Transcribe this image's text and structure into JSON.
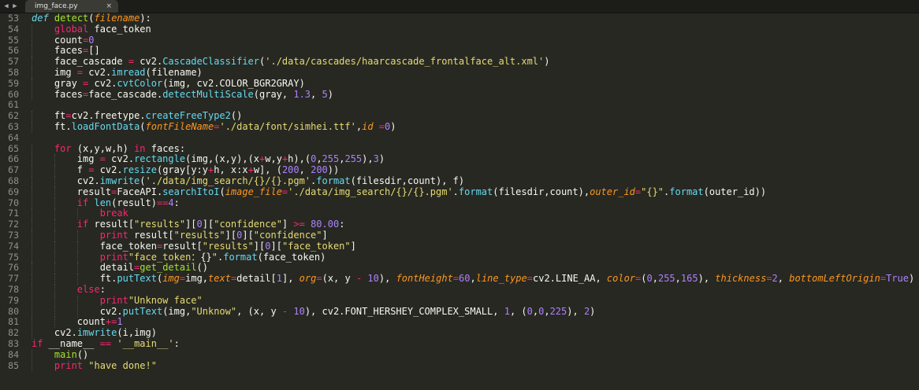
{
  "tabs": [
    {
      "title": "img_face.py",
      "close_glyph": "×"
    }
  ],
  "nav": {
    "left": "◀",
    "right": "▶"
  },
  "theme": {
    "background": "#272822",
    "keyword": "#f92672",
    "function": "#a6e22e",
    "builtin": "#66d9ef",
    "string": "#e6db74",
    "number": "#ae81ff",
    "argument": "#fd971f",
    "text": "#f8f8f2",
    "gutter": "#8f908a"
  },
  "lines": [
    {
      "n": "53",
      "indent": 0,
      "tokens": [
        [
          "st",
          "def"
        ],
        [
          "pl",
          " "
        ],
        [
          "fn",
          "detect"
        ],
        [
          "pl",
          "("
        ],
        [
          "arg",
          "filename"
        ],
        [
          "pl",
          "):"
        ]
      ]
    },
    {
      "n": "54",
      "indent": 1,
      "tokens": [
        [
          "kw",
          "global"
        ],
        [
          "pl",
          " face_token"
        ]
      ]
    },
    {
      "n": "55",
      "indent": 1,
      "tokens": [
        [
          "pl",
          "count"
        ],
        [
          "op",
          "="
        ],
        [
          "num",
          "0"
        ]
      ]
    },
    {
      "n": "56",
      "indent": 1,
      "tokens": [
        [
          "pl",
          "faces"
        ],
        [
          "op",
          "="
        ],
        [
          "pl",
          "[]"
        ]
      ]
    },
    {
      "n": "57",
      "indent": 1,
      "tokens": [
        [
          "pl",
          "face_cascade "
        ],
        [
          "op",
          "="
        ],
        [
          "pl",
          " cv2."
        ],
        [
          "fc",
          "CascadeClassifier"
        ],
        [
          "pl",
          "("
        ],
        [
          "str",
          "'./data/cascades/haarcascade_frontalface_alt.xml'"
        ],
        [
          "pl",
          ")"
        ]
      ]
    },
    {
      "n": "58",
      "indent": 1,
      "tokens": [
        [
          "pl",
          "img "
        ],
        [
          "op",
          "="
        ],
        [
          "pl",
          " cv2."
        ],
        [
          "fc",
          "imread"
        ],
        [
          "pl",
          "(filename)"
        ]
      ]
    },
    {
      "n": "59",
      "indent": 1,
      "tokens": [
        [
          "pl",
          "gray "
        ],
        [
          "op",
          "="
        ],
        [
          "pl",
          " cv2."
        ],
        [
          "fc",
          "cvtColor"
        ],
        [
          "pl",
          "(img, cv2.COLOR_BGR2GRAY)"
        ]
      ]
    },
    {
      "n": "60",
      "indent": 1,
      "tokens": [
        [
          "pl",
          "faces"
        ],
        [
          "op",
          "="
        ],
        [
          "pl",
          "face_cascade."
        ],
        [
          "fc",
          "detectMultiScale"
        ],
        [
          "pl",
          "(gray, "
        ],
        [
          "num",
          "1.3"
        ],
        [
          "pl",
          ", "
        ],
        [
          "num",
          "5"
        ],
        [
          "pl",
          ")"
        ]
      ]
    },
    {
      "n": "61",
      "indent": 0,
      "tokens": []
    },
    {
      "n": "62",
      "indent": 1,
      "tokens": [
        [
          "pl",
          "ft"
        ],
        [
          "op",
          "="
        ],
        [
          "pl",
          "cv2.freetype."
        ],
        [
          "fc",
          "createFreeType2"
        ],
        [
          "pl",
          "()"
        ]
      ]
    },
    {
      "n": "63",
      "indent": 1,
      "tokens": [
        [
          "pl",
          "ft."
        ],
        [
          "fc",
          "loadFontData"
        ],
        [
          "pl",
          "("
        ],
        [
          "arg",
          "fontFileName"
        ],
        [
          "op",
          "="
        ],
        [
          "str",
          "'./data/font/simhei.ttf'"
        ],
        [
          "pl",
          ","
        ],
        [
          "arg",
          "id"
        ],
        [
          "pl",
          " "
        ],
        [
          "op",
          "="
        ],
        [
          "num",
          "0"
        ],
        [
          "pl",
          ")"
        ]
      ]
    },
    {
      "n": "64",
      "indent": 0,
      "tokens": []
    },
    {
      "n": "65",
      "indent": 1,
      "tokens": [
        [
          "kw",
          "for"
        ],
        [
          "pl",
          " (x,y,w,h) "
        ],
        [
          "kw",
          "in"
        ],
        [
          "pl",
          " faces:"
        ]
      ]
    },
    {
      "n": "66",
      "indent": 2,
      "tokens": [
        [
          "pl",
          "img "
        ],
        [
          "op",
          "="
        ],
        [
          "pl",
          " cv2."
        ],
        [
          "fc",
          "rectangle"
        ],
        [
          "pl",
          "(img,(x,y),(x"
        ],
        [
          "op",
          "+"
        ],
        [
          "pl",
          "w,y"
        ],
        [
          "op",
          "+"
        ],
        [
          "pl",
          "h),("
        ],
        [
          "num",
          "0"
        ],
        [
          "pl",
          ","
        ],
        [
          "num",
          "255"
        ],
        [
          "pl",
          ","
        ],
        [
          "num",
          "255"
        ],
        [
          "pl",
          "),"
        ],
        [
          "num",
          "3"
        ],
        [
          "pl",
          ")"
        ]
      ]
    },
    {
      "n": "67",
      "indent": 2,
      "tokens": [
        [
          "pl",
          "f "
        ],
        [
          "op",
          "="
        ],
        [
          "pl",
          " cv2."
        ],
        [
          "fc",
          "resize"
        ],
        [
          "pl",
          "(gray[y:y"
        ],
        [
          "op",
          "+"
        ],
        [
          "pl",
          "h, x:x"
        ],
        [
          "op",
          "+"
        ],
        [
          "pl",
          "w], ("
        ],
        [
          "num",
          "200"
        ],
        [
          "pl",
          ", "
        ],
        [
          "num",
          "200"
        ],
        [
          "pl",
          "))"
        ]
      ]
    },
    {
      "n": "68",
      "indent": 2,
      "tokens": [
        [
          "pl",
          "cv2."
        ],
        [
          "fc",
          "imwrite"
        ],
        [
          "pl",
          "("
        ],
        [
          "str",
          "'./data/img_search/{}/{}.pgm'"
        ],
        [
          "pl",
          "."
        ],
        [
          "fc",
          "format"
        ],
        [
          "pl",
          "(filesdir,count), f)"
        ]
      ]
    },
    {
      "n": "69",
      "indent": 2,
      "tokens": [
        [
          "pl",
          "result"
        ],
        [
          "op",
          "="
        ],
        [
          "pl",
          "FaceAPI."
        ],
        [
          "fc",
          "searchItoI"
        ],
        [
          "pl",
          "("
        ],
        [
          "arg",
          "image_file"
        ],
        [
          "op",
          "="
        ],
        [
          "str",
          "'./data/img_search/{}/{}.pgm'"
        ],
        [
          "pl",
          "."
        ],
        [
          "fc",
          "format"
        ],
        [
          "pl",
          "(filesdir,count),"
        ],
        [
          "arg",
          "outer_id"
        ],
        [
          "op",
          "="
        ],
        [
          "str",
          "\"{}\""
        ],
        [
          "pl",
          "."
        ],
        [
          "fc",
          "format"
        ],
        [
          "pl",
          "(outer_id))"
        ]
      ]
    },
    {
      "n": "70",
      "indent": 2,
      "tokens": [
        [
          "kw",
          "if"
        ],
        [
          "pl",
          " "
        ],
        [
          "fc",
          "len"
        ],
        [
          "pl",
          "(result)"
        ],
        [
          "op",
          "=="
        ],
        [
          "num",
          "4"
        ],
        [
          "pl",
          ":"
        ]
      ]
    },
    {
      "n": "71",
      "indent": 3,
      "tokens": [
        [
          "kw",
          "break"
        ]
      ]
    },
    {
      "n": "72",
      "indent": 2,
      "tokens": [
        [
          "kw",
          "if"
        ],
        [
          "pl",
          " result["
        ],
        [
          "str",
          "\"results\""
        ],
        [
          "pl",
          "]["
        ],
        [
          "num",
          "0"
        ],
        [
          "pl",
          "]["
        ],
        [
          "str",
          "\"confidence\""
        ],
        [
          "pl",
          "] "
        ],
        [
          "op",
          ">="
        ],
        [
          "pl",
          " "
        ],
        [
          "num",
          "80.00"
        ],
        [
          "pl",
          ":"
        ]
      ]
    },
    {
      "n": "73",
      "indent": 3,
      "tokens": [
        [
          "kw",
          "print"
        ],
        [
          "pl",
          " result["
        ],
        [
          "str",
          "\"results\""
        ],
        [
          "pl",
          "]["
        ],
        [
          "num",
          "0"
        ],
        [
          "pl",
          "]["
        ],
        [
          "str",
          "\"confidence\""
        ],
        [
          "pl",
          "]"
        ]
      ]
    },
    {
      "n": "74",
      "indent": 3,
      "tokens": [
        [
          "pl",
          "face_token"
        ],
        [
          "op",
          "="
        ],
        [
          "pl",
          "result["
        ],
        [
          "str",
          "\"results\""
        ],
        [
          "pl",
          "]["
        ],
        [
          "num",
          "0"
        ],
        [
          "pl",
          "]["
        ],
        [
          "str",
          "\"face_token\""
        ],
        [
          "pl",
          "]"
        ]
      ]
    },
    {
      "n": "75",
      "indent": 3,
      "tokens": [
        [
          "kw",
          "print"
        ],
        [
          "str",
          "\"face_token："
        ],
        [
          "pl",
          "{}"
        ],
        [
          "str",
          "\""
        ],
        [
          "pl",
          "."
        ],
        [
          "fc",
          "format"
        ],
        [
          "pl",
          "(face_token)"
        ]
      ]
    },
    {
      "n": "76",
      "indent": 3,
      "tokens": [
        [
          "pl",
          "detail"
        ],
        [
          "op",
          "="
        ],
        [
          "fn",
          "get_detail"
        ],
        [
          "pl",
          "()"
        ]
      ]
    },
    {
      "n": "77",
      "indent": 3,
      "tokens": [
        [
          "pl",
          "ft."
        ],
        [
          "fc",
          "putText"
        ],
        [
          "pl",
          "("
        ],
        [
          "arg",
          "img"
        ],
        [
          "op",
          "="
        ],
        [
          "pl",
          "img,"
        ],
        [
          "arg",
          "text"
        ],
        [
          "op",
          "="
        ],
        [
          "pl",
          "detail["
        ],
        [
          "num",
          "1"
        ],
        [
          "pl",
          "], "
        ],
        [
          "arg",
          "org"
        ],
        [
          "op",
          "="
        ],
        [
          "pl",
          "(x, y "
        ],
        [
          "op",
          "-"
        ],
        [
          "pl",
          " "
        ],
        [
          "num",
          "10"
        ],
        [
          "pl",
          "), "
        ],
        [
          "arg",
          "fontHeight"
        ],
        [
          "op",
          "="
        ],
        [
          "num",
          "60"
        ],
        [
          "pl",
          ","
        ],
        [
          "arg",
          "line_type"
        ],
        [
          "op",
          "="
        ],
        [
          "pl",
          "cv2.LINE_AA, "
        ],
        [
          "arg",
          "color"
        ],
        [
          "op",
          "="
        ],
        [
          "pl",
          "("
        ],
        [
          "num",
          "0"
        ],
        [
          "pl",
          ","
        ],
        [
          "num",
          "255"
        ],
        [
          "pl",
          ","
        ],
        [
          "num",
          "165"
        ],
        [
          "pl",
          "), "
        ],
        [
          "arg",
          "thickness"
        ],
        [
          "op",
          "="
        ],
        [
          "num",
          "2"
        ],
        [
          "pl",
          ", "
        ],
        [
          "arg",
          "bottomLeftOrigin"
        ],
        [
          "op",
          "="
        ],
        [
          "num",
          "True"
        ],
        [
          "pl",
          ")"
        ]
      ]
    },
    {
      "n": "78",
      "indent": 2,
      "tokens": [
        [
          "kw",
          "else"
        ],
        [
          "pl",
          ":"
        ]
      ]
    },
    {
      "n": "79",
      "indent": 3,
      "tokens": [
        [
          "kw",
          "print"
        ],
        [
          "str",
          "\"Unknow face\""
        ]
      ]
    },
    {
      "n": "80",
      "indent": 3,
      "tokens": [
        [
          "pl",
          "cv2."
        ],
        [
          "fc",
          "putText"
        ],
        [
          "pl",
          "(img,"
        ],
        [
          "str",
          "\"Unknow\""
        ],
        [
          "pl",
          ", (x, y "
        ],
        [
          "op",
          "-"
        ],
        [
          "pl",
          " "
        ],
        [
          "num",
          "10"
        ],
        [
          "pl",
          "), cv2.FONT_HERSHEY_COMPLEX_SMALL, "
        ],
        [
          "num",
          "1"
        ],
        [
          "pl",
          ", ("
        ],
        [
          "num",
          "0"
        ],
        [
          "pl",
          ","
        ],
        [
          "num",
          "0"
        ],
        [
          "pl",
          ","
        ],
        [
          "num",
          "225"
        ],
        [
          "pl",
          "), "
        ],
        [
          "num",
          "2"
        ],
        [
          "pl",
          ")"
        ]
      ]
    },
    {
      "n": "81",
      "indent": 2,
      "tokens": [
        [
          "pl",
          "count"
        ],
        [
          "op",
          "+="
        ],
        [
          "num",
          "1"
        ]
      ]
    },
    {
      "n": "82",
      "indent": 1,
      "tokens": [
        [
          "pl",
          "cv2."
        ],
        [
          "fc",
          "imwrite"
        ],
        [
          "pl",
          "(i,img)"
        ]
      ]
    },
    {
      "n": "83",
      "indent": 0,
      "tokens": [
        [
          "kw",
          "if"
        ],
        [
          "pl",
          " __name__ "
        ],
        [
          "op",
          "=="
        ],
        [
          "pl",
          " "
        ],
        [
          "str",
          "'__main__'"
        ],
        [
          "pl",
          ":"
        ]
      ]
    },
    {
      "n": "84",
      "indent": 1,
      "tokens": [
        [
          "fn",
          "main"
        ],
        [
          "pl",
          "()"
        ]
      ]
    },
    {
      "n": "85",
      "indent": 1,
      "tokens": [
        [
          "kw",
          "print"
        ],
        [
          "pl",
          " "
        ],
        [
          "str",
          "\"have done!\""
        ]
      ]
    }
  ]
}
